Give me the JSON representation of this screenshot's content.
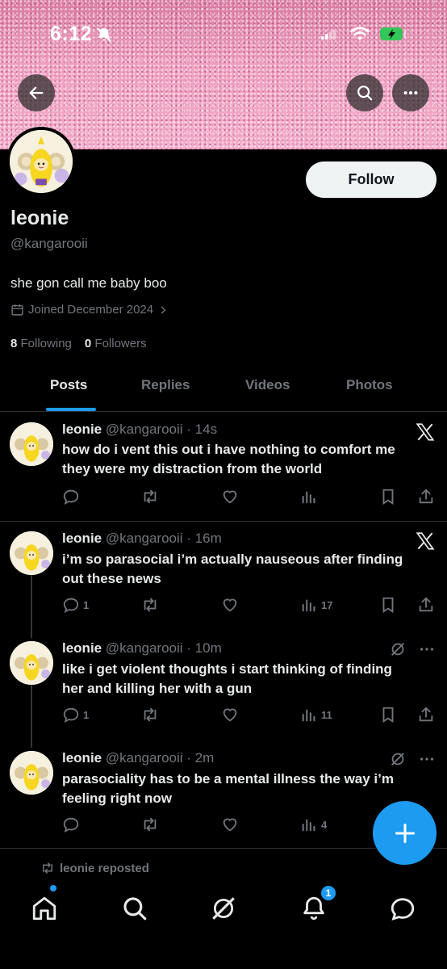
{
  "status_bar": {
    "time": "6:12"
  },
  "profile": {
    "display_name": "leonie",
    "handle": "@kangarooii",
    "bio": "she gon call me baby boo",
    "joined": "Joined December 2024",
    "following_count": "8",
    "following_label": "Following",
    "followers_count": "0",
    "followers_label": "Followers",
    "follow_button": "Follow"
  },
  "tabs": [
    {
      "label": "Posts",
      "active": true
    },
    {
      "label": "Replies",
      "active": false
    },
    {
      "label": "Videos",
      "active": false
    },
    {
      "label": "Photos",
      "active": false
    }
  ],
  "posts": [
    {
      "name": "leonie",
      "handle": "@kangarooii",
      "time": "· 14s",
      "text": "how do i vent this out i have nothing to comfort me they were my distraction from the world",
      "replies": "",
      "views": ""
    },
    {
      "name": "leonie",
      "handle": "@kangarooii",
      "time": "· 16m",
      "text": "i’m so parasocial i’m actually nauseous after finding out these news",
      "replies": "1",
      "views": "17"
    },
    {
      "name": "leonie",
      "handle": "@kangarooii",
      "time": "· 10m",
      "text": "like i get violent thoughts i start thinking of finding her and killing her with a gun",
      "replies": "1",
      "views": "11"
    },
    {
      "name": "leonie",
      "handle": "@kangarooii",
      "time": "· 2m",
      "text": "parasociality has to be a mental illness the way i’m feeling right now",
      "replies": "",
      "views": "4"
    }
  ],
  "reposted_label": "leonie reposted",
  "notifications_badge": "1",
  "colors": {
    "accent": "#1d9bf0",
    "muted": "#71767b",
    "text": "#e7e9ea",
    "background": "#000000"
  }
}
